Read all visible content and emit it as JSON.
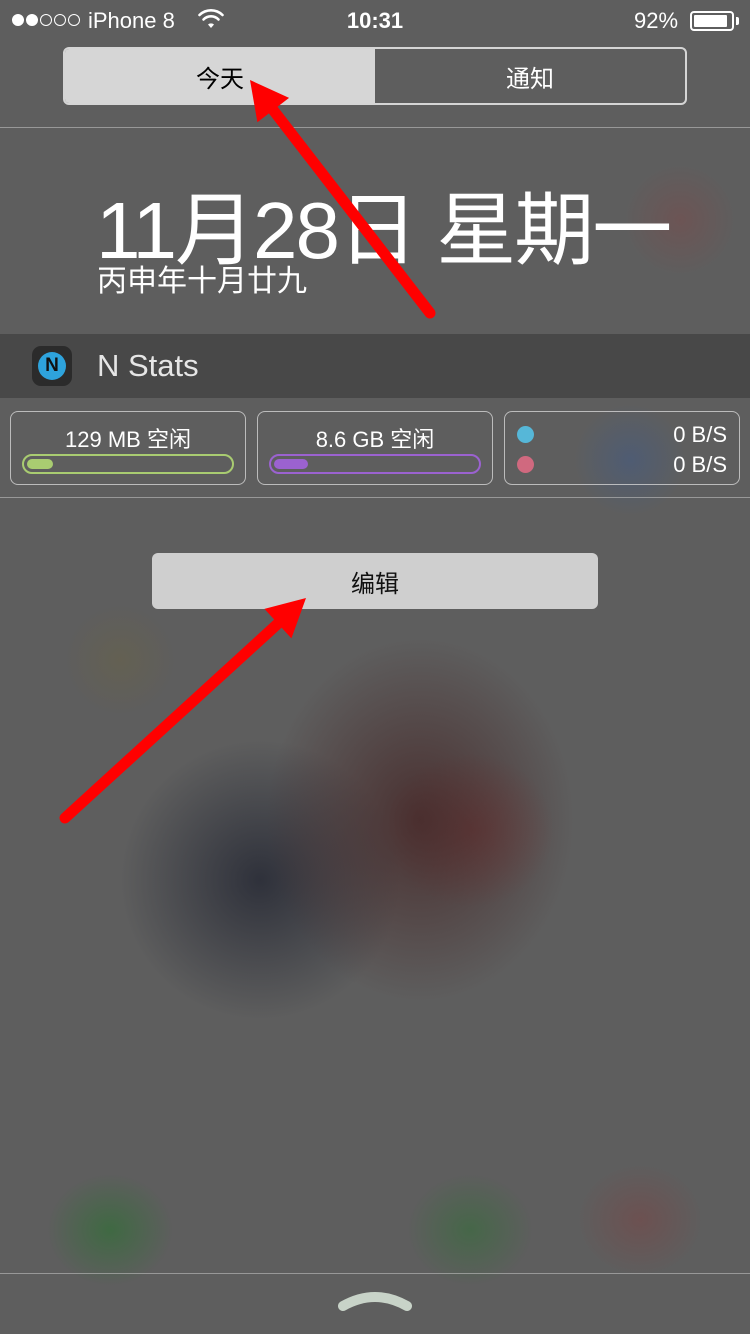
{
  "status_bar": {
    "carrier": "iPhone 8",
    "time": "10:31",
    "battery_percent": "92%",
    "battery_level": 0.92,
    "signal_bars_filled": 2,
    "signal_bars_total": 5
  },
  "tabs": [
    {
      "label": "今天",
      "active": true
    },
    {
      "label": "通知",
      "active": false
    }
  ],
  "today": {
    "date": "11月28日 星期一",
    "lunar_date": "丙申年十月廿九"
  },
  "widget": {
    "title": "N Stats",
    "icon_letter": "N",
    "memory": {
      "label": "129 MB 空闲",
      "fill_fraction": 0.13,
      "color": "#a9cc71"
    },
    "storage": {
      "label": "8.6 GB 空闲",
      "fill_fraction": 0.17,
      "color": "#9b62d0"
    },
    "network": {
      "download": {
        "value": "0 B/S",
        "color": "#56b7d8"
      },
      "upload": {
        "value": "0 B/S",
        "color": "#d0697f"
      }
    }
  },
  "edit_button": {
    "label": "编辑"
  },
  "annotation_color": "#ff0000"
}
